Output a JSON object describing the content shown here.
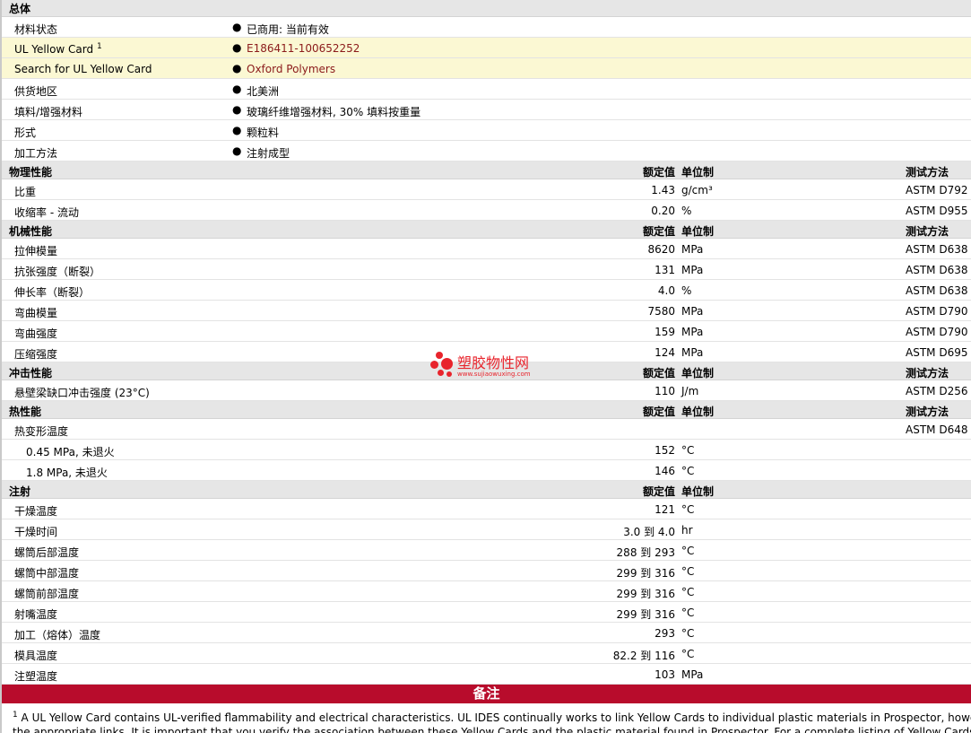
{
  "general": {
    "title": "总体",
    "rows": [
      {
        "label": "材料状态",
        "value": "已商用: 当前有效"
      },
      {
        "label": "UL Yellow Card",
        "sup": "1",
        "value": "E186411-100652252"
      },
      {
        "label": "Search for UL Yellow Card",
        "value": "Oxford Polymers"
      },
      {
        "label": "供货地区",
        "value": "北美洲"
      },
      {
        "label": "填料/增强材料",
        "value": "玻璃纤维增强材料, 30% 填料按重量"
      },
      {
        "label": "形式",
        "value": "颗粒料"
      },
      {
        "label": "加工方法",
        "value": "注射成型"
      }
    ]
  },
  "headers": {
    "nominal": "额定值",
    "unit": "单位制",
    "method": "测试方法"
  },
  "physical": {
    "title": "物理性能",
    "rows": [
      {
        "label": "比重",
        "value": "1.43",
        "unit": "g/cm³",
        "method": "ASTM D792"
      },
      {
        "label": "收缩率 - 流动",
        "value": "0.20",
        "unit": "%",
        "method": "ASTM D955"
      }
    ]
  },
  "mechanical": {
    "title": "机械性能",
    "rows": [
      {
        "label": "拉伸模量",
        "value": "8620",
        "unit": "MPa",
        "method": "ASTM D638"
      },
      {
        "label": "抗张强度（断裂）",
        "value": "131",
        "unit": "MPa",
        "method": "ASTM D638"
      },
      {
        "label": "伸长率（断裂）",
        "value": "4.0",
        "unit": "%",
        "method": "ASTM D638"
      },
      {
        "label": "弯曲模量",
        "value": "7580",
        "unit": "MPa",
        "method": "ASTM D790"
      },
      {
        "label": "弯曲强度",
        "value": "159",
        "unit": "MPa",
        "method": "ASTM D790"
      },
      {
        "label": "压缩强度",
        "value": "124",
        "unit": "MPa",
        "method": "ASTM D695"
      }
    ]
  },
  "impact": {
    "title": "冲击性能",
    "rows": [
      {
        "label": "悬壁梁缺口冲击强度 (23°C)",
        "value": "110",
        "unit": "J/m",
        "method": "ASTM D256"
      }
    ]
  },
  "thermal": {
    "title": "热性能",
    "rows": [
      {
        "label": "热变形温度",
        "value": "",
        "unit": "",
        "method": "ASTM D648"
      },
      {
        "label": "0.45 MPa, 未退火",
        "value": "152",
        "unit": "°C",
        "method": ""
      },
      {
        "label": "1.8 MPa, 未退火",
        "value": "146",
        "unit": "°C",
        "method": ""
      }
    ]
  },
  "injection": {
    "title": "注射",
    "rows": [
      {
        "label": "干燥温度",
        "value": "121",
        "unit": "°C"
      },
      {
        "label": "干燥时间",
        "value": "3.0 到  4.0",
        "unit": "hr"
      },
      {
        "label": "螺筒后部温度",
        "value": "288 到  293",
        "unit": "°C"
      },
      {
        "label": "螺筒中部温度",
        "value": "299 到  316",
        "unit": "°C"
      },
      {
        "label": "螺筒前部温度",
        "value": "299 到  316",
        "unit": "°C"
      },
      {
        "label": "射嘴温度",
        "value": "299 到  316",
        "unit": "°C"
      },
      {
        "label": "加工（熔体）温度",
        "value": "293",
        "unit": "°C"
      },
      {
        "label": "模具温度",
        "value": "82.2 到  116",
        "unit": "°C"
      },
      {
        "label": "注塑温度",
        "value": "103",
        "unit": "MPa"
      }
    ]
  },
  "notes": {
    "title": "备注",
    "sup": "1",
    "line1": " A UL Yellow Card contains UL-verified flammability and electrical characteristics. UL IDES continually works to link Yellow Cards to individual plastic materials in Prospector, however th",
    "line2": "the appropriate links. It is important that you verify the association between these Yellow Cards and the plastic material found in Prospector. For a complete listing of Yellow Cards, visit the"
  },
  "watermark": {
    "name": "塑胶物性网",
    "url": "www.sujiaowuxing.com"
  },
  "colors": {
    "notes_bar": "#b80c2c",
    "link": "#8b1a1a",
    "highlight": "#fbf8d3",
    "watermark": "#e8242c"
  }
}
